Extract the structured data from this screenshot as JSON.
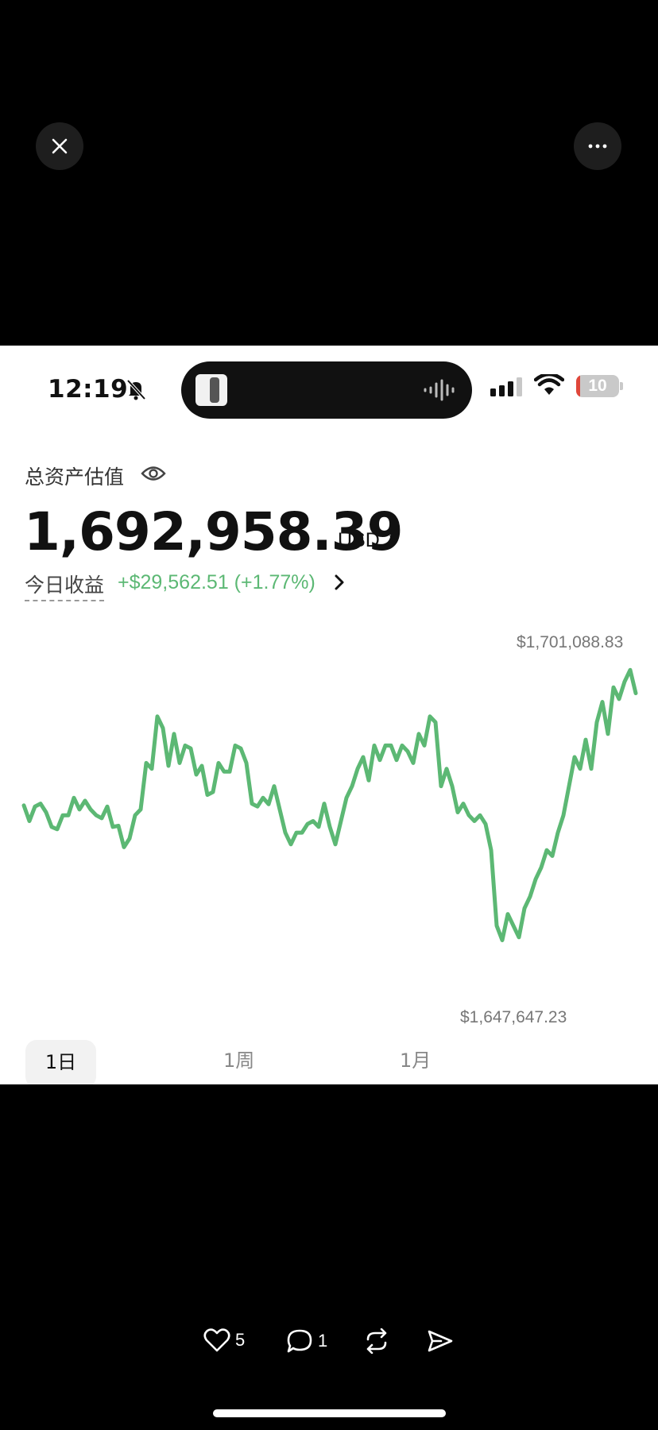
{
  "viewer": {
    "close_icon": "close-icon",
    "more_icon": "more-icon"
  },
  "status_bar": {
    "time": "12:19",
    "battery_level": "10",
    "battery_fraction": 0.1,
    "battery_color": "#e0463a"
  },
  "account": {
    "total_assets_label": "总资产估值",
    "total_value": "1,692,958.39",
    "currency": "USD",
    "daily_pnl_label": "今日收益",
    "daily_pnl_value": "+$29,562.51 (+1.77%)",
    "positive_color": "#5cb874"
  },
  "chart_data": {
    "type": "line",
    "max_label": "$1,701,088.83",
    "min_label": "$1,647,647.23",
    "ylim": [
      1645000,
      1703500
    ],
    "color": "#5cb874",
    "values": [
      1677700,
      1675000,
      1677500,
      1678000,
      1676500,
      1674000,
      1673600,
      1676000,
      1676000,
      1679000,
      1677000,
      1678500,
      1677000,
      1676000,
      1675500,
      1677500,
      1674000,
      1674200,
      1670500,
      1672000,
      1676000,
      1677000,
      1685000,
      1684000,
      1693000,
      1691000,
      1684500,
      1690000,
      1685000,
      1688000,
      1687500,
      1683000,
      1684500,
      1679500,
      1680000,
      1685000,
      1683500,
      1683500,
      1688000,
      1687500,
      1685000,
      1678000,
      1677500,
      1679000,
      1677900,
      1681000,
      1677000,
      1673000,
      1671000,
      1673000,
      1673000,
      1674500,
      1675000,
      1674000,
      1678000,
      1674000,
      1671000,
      1675000,
      1679000,
      1681000,
      1684000,
      1686000,
      1682000,
      1688000,
      1685500,
      1688000,
      1688000,
      1685500,
      1688000,
      1687000,
      1685000,
      1690000,
      1688000,
      1693000,
      1692000,
      1681000,
      1684000,
      1681000,
      1676500,
      1678000,
      1676000,
      1675000,
      1676000,
      1674500,
      1670000,
      1657000,
      1654500,
      1659000,
      1657000,
      1655000,
      1660000,
      1662000,
      1665000,
      1667000,
      1670000,
      1669000,
      1673000,
      1676000,
      1681000,
      1686000,
      1684000,
      1689000,
      1684000,
      1692000,
      1695500,
      1690000,
      1698000,
      1696000,
      1699000,
      1701000,
      1697000
    ]
  },
  "time_tabs": [
    {
      "label": "1日",
      "active": true
    },
    {
      "label": "1周",
      "active": false
    },
    {
      "label": "1月",
      "active": false
    }
  ],
  "actions": {
    "likes": "5",
    "comments": "1",
    "repost_icon": "repost-icon",
    "share_icon": "share-icon"
  }
}
